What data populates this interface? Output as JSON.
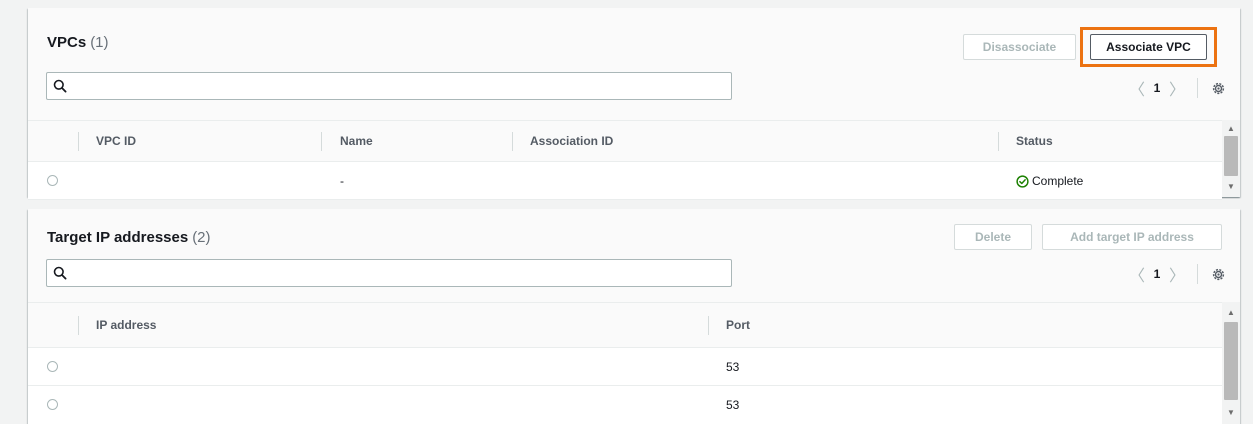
{
  "vpcs_panel": {
    "title": "VPCs",
    "count": "(1)",
    "disassociate_label": "Disassociate",
    "associate_label": "Associate VPC",
    "search": {
      "value": "",
      "placeholder": ""
    },
    "pagination": {
      "prev_icon": "chevron-left-icon",
      "page": "1",
      "next_icon": "chevron-right-icon",
      "settings_icon": "gear-icon"
    },
    "columns": [
      "VPC ID",
      "Name",
      "Association ID",
      "Status"
    ],
    "rows": [
      {
        "vpc_id": "",
        "name": "-",
        "association_id": "",
        "status": "Complete",
        "status_icon": "check-circle-icon"
      }
    ]
  },
  "target_ip_panel": {
    "title": "Target IP addresses",
    "count": "(2)",
    "delete_label": "Delete",
    "add_label": "Add target IP address",
    "search": {
      "value": "",
      "placeholder": ""
    },
    "pagination": {
      "prev_icon": "chevron-left-icon",
      "page": "1",
      "next_icon": "chevron-right-icon",
      "settings_icon": "gear-icon"
    },
    "columns": [
      "IP address",
      "Port"
    ],
    "rows": [
      {
        "ip_address": "",
        "port": "53"
      },
      {
        "ip_address": "",
        "port": "53"
      }
    ]
  },
  "colors": {
    "highlight": "#ec7211",
    "status_success": "#1d8102",
    "disabled_text": "#aab7b8",
    "header_bg": "#fafafa"
  }
}
